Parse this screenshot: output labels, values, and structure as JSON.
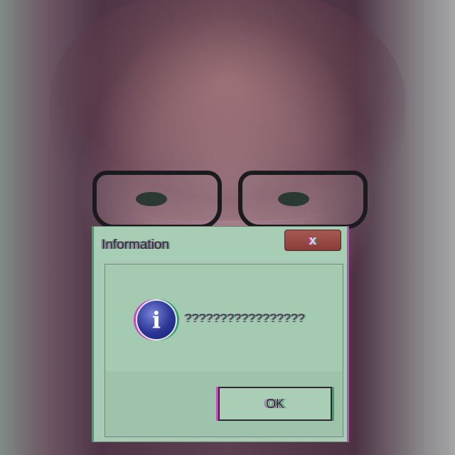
{
  "dialog": {
    "title": "Information",
    "close_label": "x",
    "message": "?????????????????",
    "ok_label": "OK",
    "icon": "info-icon"
  },
  "colors": {
    "dialog_bg": "#a9cbb6",
    "close_button": "#8a3d38",
    "icon_blue": "#2a3597"
  }
}
